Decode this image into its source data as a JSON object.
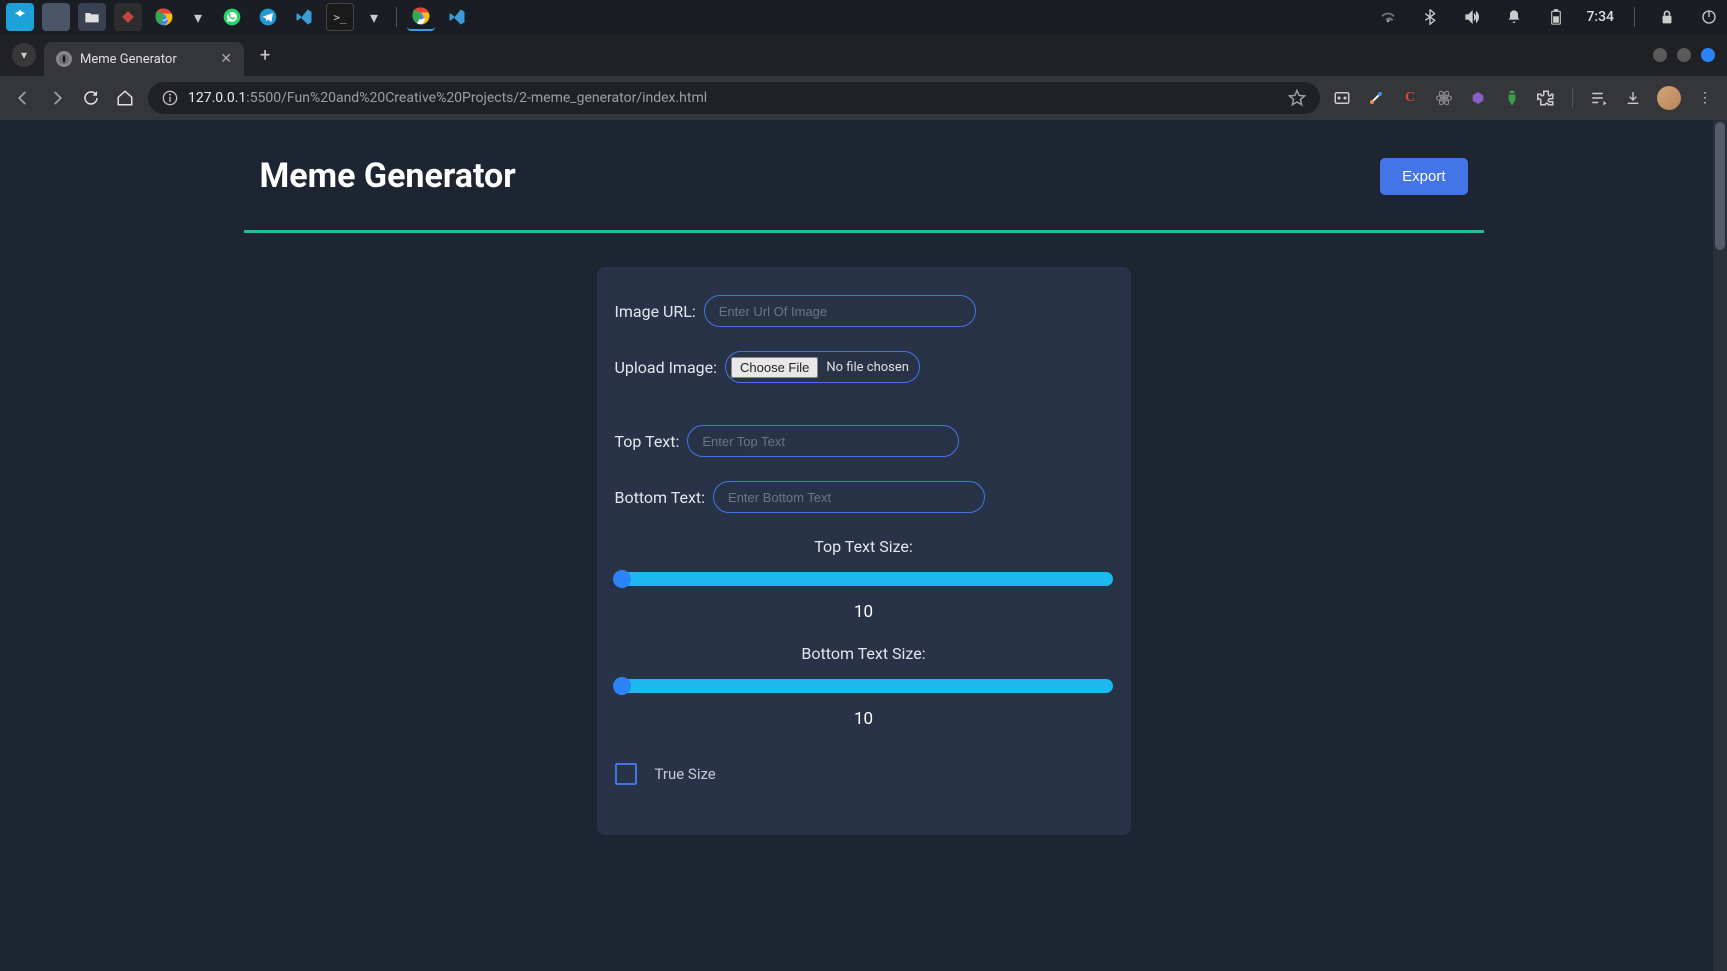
{
  "os": {
    "clock": "7:34"
  },
  "browser": {
    "tab_title": "Meme Generator",
    "url_host": "127.0.0.1",
    "url_path": ":5500/Fun%20and%20Creative%20Projects/2-meme_generator/index.html"
  },
  "page": {
    "title": "Meme Generator",
    "export_label": "Export"
  },
  "form": {
    "image_url": {
      "label": "Image URL:",
      "placeholder": "Enter Url Of Image"
    },
    "upload": {
      "label": "Upload Image:",
      "button": "Choose File",
      "status": "No file chosen"
    },
    "top_text": {
      "label": "Top Text:",
      "placeholder": "Enter Top Text"
    },
    "bottom_text": {
      "label": "Bottom Text:",
      "placeholder": "Enter Bottom Text"
    },
    "top_size": {
      "label": "Top Text Size:",
      "value": "10"
    },
    "bottom_size": {
      "label": "Bottom Text Size:",
      "value": "10"
    },
    "true_size_label": "True Size"
  }
}
